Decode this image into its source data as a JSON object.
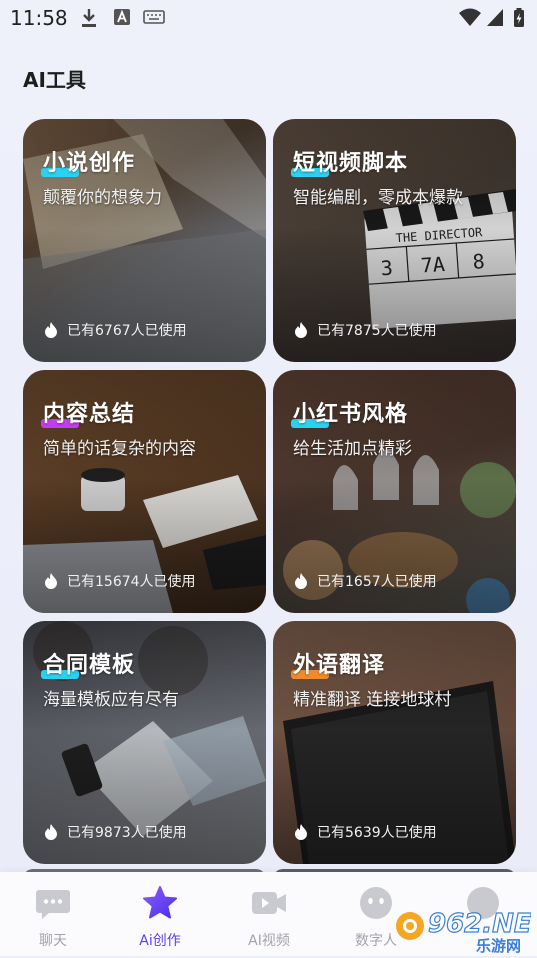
{
  "status_bar": {
    "time": "11:58"
  },
  "page_title": "AI工具",
  "cards": [
    {
      "title": "小说创作",
      "subtitle": "颠覆你的想象力",
      "usage": "已有6767人已使用",
      "accent": "#2bd2f0"
    },
    {
      "title": "短视频脚本",
      "subtitle": "智能编剧，零成本爆款",
      "usage": "已有7875人已使用",
      "accent": "#2bd2f0"
    },
    {
      "title": "内容总结",
      "subtitle": "简单的话复杂的内容",
      "usage": "已有15674人已使用",
      "accent": "#c23cf2"
    },
    {
      "title": "小红书风格",
      "subtitle": "给生活加点精彩",
      "usage": "已有1657人已使用",
      "accent": "#2bd2f0"
    },
    {
      "title": "合同模板",
      "subtitle": "海量模板应有尽有",
      "usage": "已有9873人已使用",
      "accent": "#2bd2f0"
    },
    {
      "title": "外语翻译",
      "subtitle": "精准翻译 连接地球村",
      "usage": "已有5639人已使用",
      "accent": "#f28a2b"
    }
  ],
  "bottom_nav": [
    {
      "label": "聊天",
      "icon": "chat-bubble-icon",
      "active": false
    },
    {
      "label": "Ai创作",
      "icon": "star-icon",
      "active": true
    },
    {
      "label": "AI视频",
      "icon": "video-camera-icon",
      "active": false
    },
    {
      "label": "数字人",
      "icon": "digital-human-icon",
      "active": false
    },
    {
      "label": "",
      "icon": "profile-icon",
      "active": false
    }
  ],
  "watermark": {
    "text": "962.NET",
    "subtext": "乐游网"
  },
  "colors": {
    "active": "#5e3cf2",
    "inactive": "#a3a3ad"
  }
}
